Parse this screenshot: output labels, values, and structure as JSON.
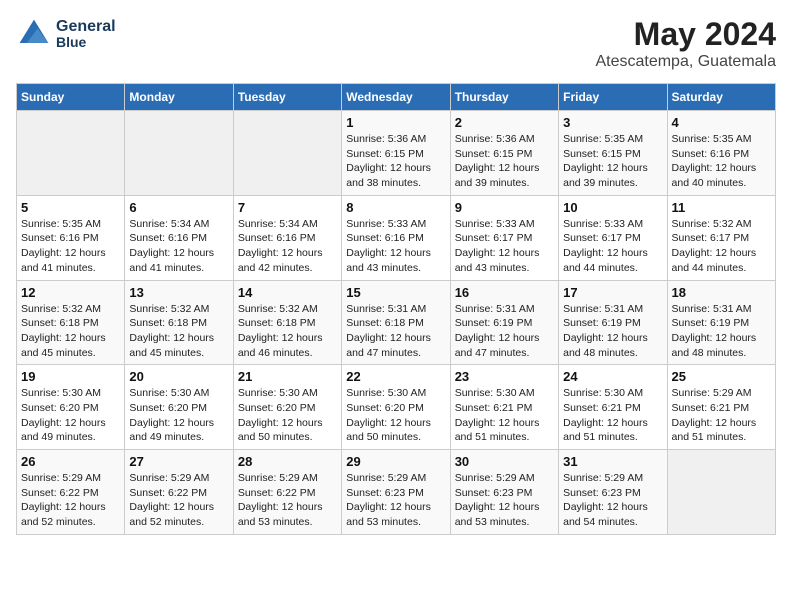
{
  "header": {
    "logo_line1": "General",
    "logo_line2": "Blue",
    "title": "May 2024",
    "subtitle": "Atescatempa, Guatemala"
  },
  "days_of_week": [
    "Sunday",
    "Monday",
    "Tuesday",
    "Wednesday",
    "Thursday",
    "Friday",
    "Saturday"
  ],
  "weeks": [
    [
      {
        "day": "",
        "detail": ""
      },
      {
        "day": "",
        "detail": ""
      },
      {
        "day": "",
        "detail": ""
      },
      {
        "day": "1",
        "detail": "Sunrise: 5:36 AM\nSunset: 6:15 PM\nDaylight: 12 hours\nand 38 minutes."
      },
      {
        "day": "2",
        "detail": "Sunrise: 5:36 AM\nSunset: 6:15 PM\nDaylight: 12 hours\nand 39 minutes."
      },
      {
        "day": "3",
        "detail": "Sunrise: 5:35 AM\nSunset: 6:15 PM\nDaylight: 12 hours\nand 39 minutes."
      },
      {
        "day": "4",
        "detail": "Sunrise: 5:35 AM\nSunset: 6:16 PM\nDaylight: 12 hours\nand 40 minutes."
      }
    ],
    [
      {
        "day": "5",
        "detail": "Sunrise: 5:35 AM\nSunset: 6:16 PM\nDaylight: 12 hours\nand 41 minutes."
      },
      {
        "day": "6",
        "detail": "Sunrise: 5:34 AM\nSunset: 6:16 PM\nDaylight: 12 hours\nand 41 minutes."
      },
      {
        "day": "7",
        "detail": "Sunrise: 5:34 AM\nSunset: 6:16 PM\nDaylight: 12 hours\nand 42 minutes."
      },
      {
        "day": "8",
        "detail": "Sunrise: 5:33 AM\nSunset: 6:16 PM\nDaylight: 12 hours\nand 43 minutes."
      },
      {
        "day": "9",
        "detail": "Sunrise: 5:33 AM\nSunset: 6:17 PM\nDaylight: 12 hours\nand 43 minutes."
      },
      {
        "day": "10",
        "detail": "Sunrise: 5:33 AM\nSunset: 6:17 PM\nDaylight: 12 hours\nand 44 minutes."
      },
      {
        "day": "11",
        "detail": "Sunrise: 5:32 AM\nSunset: 6:17 PM\nDaylight: 12 hours\nand 44 minutes."
      }
    ],
    [
      {
        "day": "12",
        "detail": "Sunrise: 5:32 AM\nSunset: 6:18 PM\nDaylight: 12 hours\nand 45 minutes."
      },
      {
        "day": "13",
        "detail": "Sunrise: 5:32 AM\nSunset: 6:18 PM\nDaylight: 12 hours\nand 45 minutes."
      },
      {
        "day": "14",
        "detail": "Sunrise: 5:32 AM\nSunset: 6:18 PM\nDaylight: 12 hours\nand 46 minutes."
      },
      {
        "day": "15",
        "detail": "Sunrise: 5:31 AM\nSunset: 6:18 PM\nDaylight: 12 hours\nand 47 minutes."
      },
      {
        "day": "16",
        "detail": "Sunrise: 5:31 AM\nSunset: 6:19 PM\nDaylight: 12 hours\nand 47 minutes."
      },
      {
        "day": "17",
        "detail": "Sunrise: 5:31 AM\nSunset: 6:19 PM\nDaylight: 12 hours\nand 48 minutes."
      },
      {
        "day": "18",
        "detail": "Sunrise: 5:31 AM\nSunset: 6:19 PM\nDaylight: 12 hours\nand 48 minutes."
      }
    ],
    [
      {
        "day": "19",
        "detail": "Sunrise: 5:30 AM\nSunset: 6:20 PM\nDaylight: 12 hours\nand 49 minutes."
      },
      {
        "day": "20",
        "detail": "Sunrise: 5:30 AM\nSunset: 6:20 PM\nDaylight: 12 hours\nand 49 minutes."
      },
      {
        "day": "21",
        "detail": "Sunrise: 5:30 AM\nSunset: 6:20 PM\nDaylight: 12 hours\nand 50 minutes."
      },
      {
        "day": "22",
        "detail": "Sunrise: 5:30 AM\nSunset: 6:20 PM\nDaylight: 12 hours\nand 50 minutes."
      },
      {
        "day": "23",
        "detail": "Sunrise: 5:30 AM\nSunset: 6:21 PM\nDaylight: 12 hours\nand 51 minutes."
      },
      {
        "day": "24",
        "detail": "Sunrise: 5:30 AM\nSunset: 6:21 PM\nDaylight: 12 hours\nand 51 minutes."
      },
      {
        "day": "25",
        "detail": "Sunrise: 5:29 AM\nSunset: 6:21 PM\nDaylight: 12 hours\nand 51 minutes."
      }
    ],
    [
      {
        "day": "26",
        "detail": "Sunrise: 5:29 AM\nSunset: 6:22 PM\nDaylight: 12 hours\nand 52 minutes."
      },
      {
        "day": "27",
        "detail": "Sunrise: 5:29 AM\nSunset: 6:22 PM\nDaylight: 12 hours\nand 52 minutes."
      },
      {
        "day": "28",
        "detail": "Sunrise: 5:29 AM\nSunset: 6:22 PM\nDaylight: 12 hours\nand 53 minutes."
      },
      {
        "day": "29",
        "detail": "Sunrise: 5:29 AM\nSunset: 6:23 PM\nDaylight: 12 hours\nand 53 minutes."
      },
      {
        "day": "30",
        "detail": "Sunrise: 5:29 AM\nSunset: 6:23 PM\nDaylight: 12 hours\nand 53 minutes."
      },
      {
        "day": "31",
        "detail": "Sunrise: 5:29 AM\nSunset: 6:23 PM\nDaylight: 12 hours\nand 54 minutes."
      },
      {
        "day": "",
        "detail": ""
      }
    ]
  ]
}
